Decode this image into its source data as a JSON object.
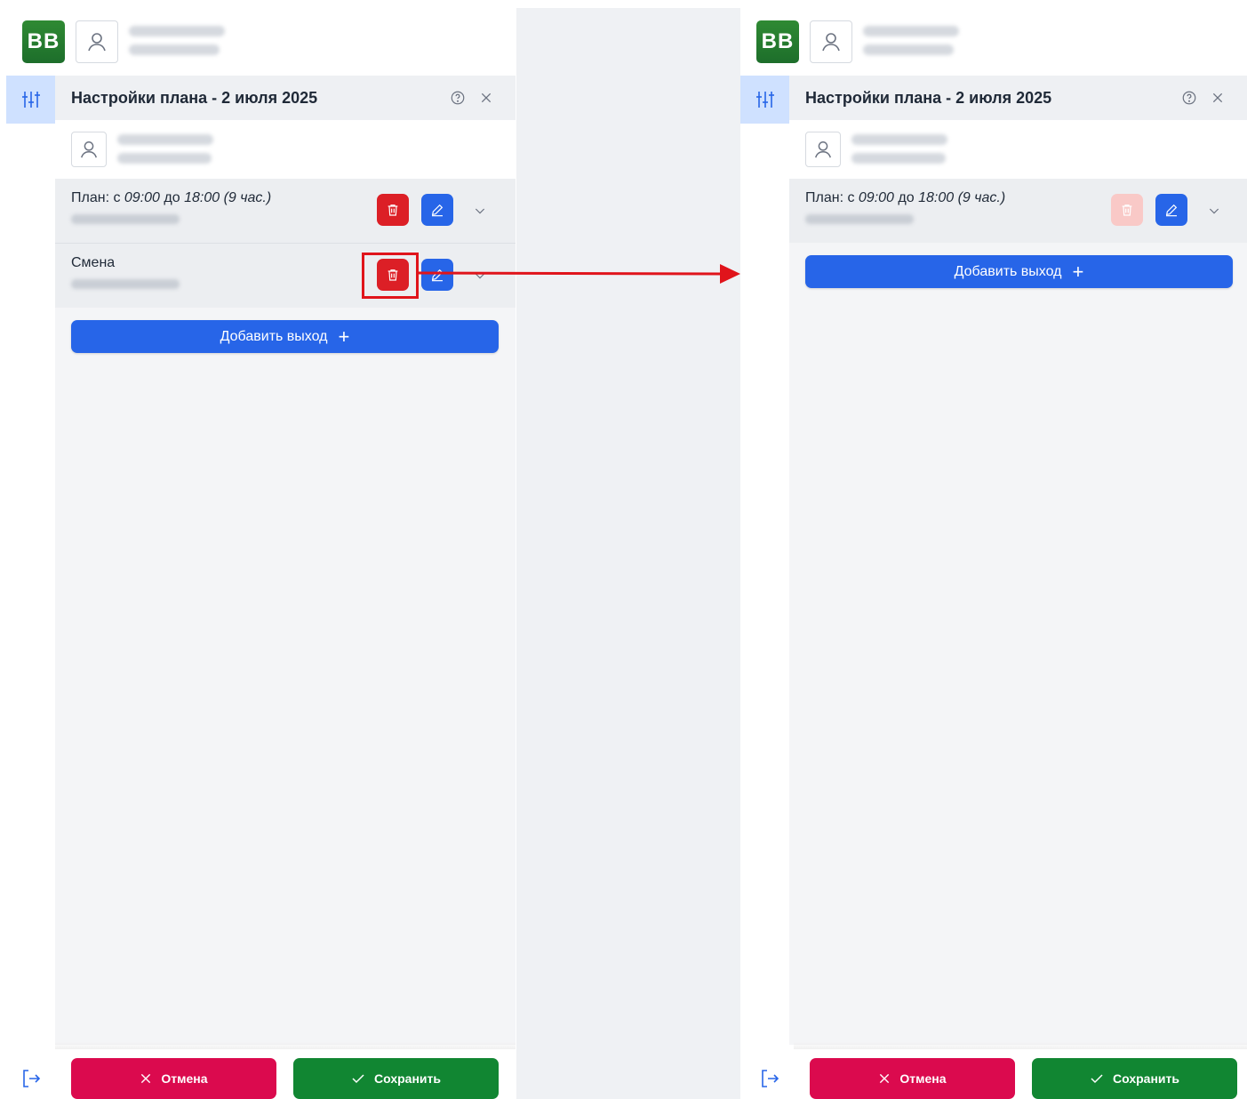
{
  "colors": {
    "brand_green": "#1d6e2b",
    "primary_blue": "#2765e8",
    "danger_red": "#dc1f26",
    "danger_red_disabled": "#f9c9c7",
    "cancel_pink": "#db0a4e",
    "save_green": "#118632",
    "annotation_red": "#e0141b"
  },
  "before": {
    "logo": "BB",
    "header": {
      "title": "Настройки плана - 2 июля 2025"
    },
    "plan_item": {
      "prefix": "План: с ",
      "from": "09:00",
      "mid": " до ",
      "to": "18:00",
      "duration": " (9 час.)"
    },
    "shift_item": {
      "label": "Смена"
    },
    "add_button": "Добавить выход",
    "footer": {
      "cancel": "Отмена",
      "save": "Сохранить"
    }
  },
  "after": {
    "logo": "BB",
    "header": {
      "title": "Настройки плана - 2 июля 2025"
    },
    "plan_item": {
      "prefix": "План: с ",
      "from": "09:00",
      "mid": " до ",
      "to": "18:00",
      "duration": " (9 час.)"
    },
    "add_button": "Добавить выход",
    "footer": {
      "cancel": "Отмена",
      "save": "Сохранить"
    }
  },
  "icons": [
    "user-icon",
    "sliders-icon",
    "help-icon",
    "close-icon",
    "trash-icon",
    "pencil-icon",
    "chevron-down-icon",
    "plus-icon",
    "logout-icon",
    "check-icon",
    "x-icon"
  ]
}
